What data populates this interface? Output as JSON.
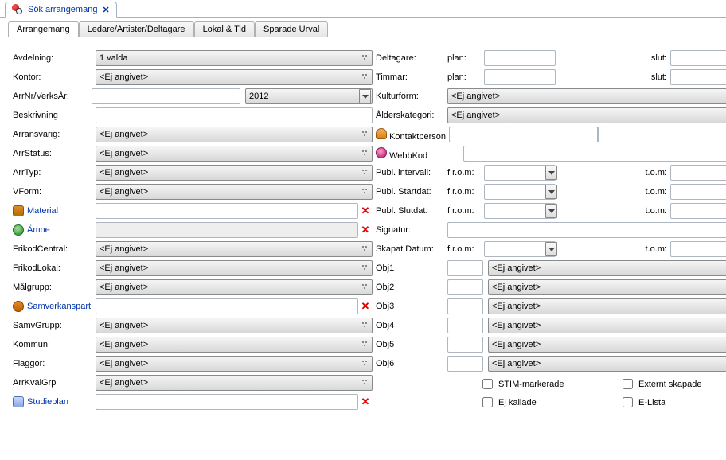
{
  "doc_tab": {
    "title": "Sök arrangemang"
  },
  "sub_tabs": {
    "t0": "Arrangemang",
    "t1": "Ledare/Artister/Deltagare",
    "t2": "Lokal & Tid",
    "t3": "Sparade Urval"
  },
  "ej_angivet": "<Ej angivet>",
  "left": {
    "avdelning": {
      "label": "Avdelning:",
      "value": "1 valda"
    },
    "kontor": {
      "label": "Kontor:",
      "value": "<Ej angivet>"
    },
    "arrnr": {
      "label": "ArrNr/VerksÅr:",
      "year": "2012"
    },
    "beskrivning": {
      "label": "Beskrivning"
    },
    "arransvarig": {
      "label": "Arransvarig:",
      "value": "<Ej angivet>"
    },
    "arrstatus": {
      "label": "ArrStatus:",
      "value": "<Ej angivet>"
    },
    "arrtyp": {
      "label": "ArrTyp:",
      "value": "<Ej angivet>"
    },
    "vform": {
      "label": "VForm:",
      "value": "<Ej angivet>"
    },
    "material": {
      "label": "Material"
    },
    "amne": {
      "label": "Ämne"
    },
    "frikodc": {
      "label": "FrikodCentral:",
      "value": "<Ej angivet>"
    },
    "frikodl": {
      "label": "FrikodLokal:",
      "value": "<Ej angivet>"
    },
    "malgrupp": {
      "label": "Målgrupp:",
      "value": "<Ej angivet>"
    },
    "samverkan": {
      "label": "Samverkanspart"
    },
    "samvgrupp": {
      "label": "SamvGrupp:",
      "value": "<Ej angivet>"
    },
    "kommun": {
      "label": "Kommun:",
      "value": "<Ej angivet>"
    },
    "flaggor": {
      "label": "Flaggor:",
      "value": "<Ej angivet>"
    },
    "arrkvalgrp": {
      "label": "ArrKvalGrp",
      "value": "<Ej angivet>"
    },
    "studieplan": {
      "label": "Studieplan"
    }
  },
  "right": {
    "deltagare": {
      "label": "Deltagare:",
      "plan": "plan:",
      "slut": "slut:"
    },
    "timmar": {
      "label": "Timmar:",
      "plan": "plan:",
      "slut": "slut:"
    },
    "kulturform": {
      "label": "Kulturform:",
      "value": "<Ej angivet>"
    },
    "alderskat": {
      "label": "Ålderskategori:",
      "value": "<Ej angivet>"
    },
    "kontaktperson": {
      "label": "Kontaktperson"
    },
    "webbkod": {
      "label": "WebbKod"
    },
    "pub_intervall": {
      "label": "Publ. intervall:",
      "from": "f.r.o.m:",
      "to": "t.o.m:"
    },
    "pub_startdat": {
      "label": "Publ. Startdat:",
      "from": "f.r.o.m:",
      "to": "t.o.m:"
    },
    "pub_slutdat": {
      "label": "Publ. Slutdat:",
      "from": "f.r.o.m:",
      "to": "t.o.m:"
    },
    "signatur": {
      "label": "Signatur:"
    },
    "skapat": {
      "label": "Skapat Datum:",
      "from": "f.r.o.m:",
      "to": "t.o.m:"
    },
    "obj": {
      "o1": "Obj1",
      "o2": "Obj2",
      "o3": "Obj3",
      "o4": "Obj4",
      "o5": "Obj5",
      "o6": "Obj6",
      "value": "<Ej angivet>"
    },
    "checks": {
      "c1": "STIM-markerade",
      "c2": "Externt skapade",
      "c3": "Ej kallade",
      "c4": "E-Lista"
    }
  }
}
